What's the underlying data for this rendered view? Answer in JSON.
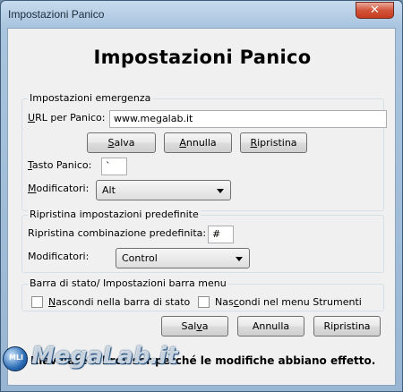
{
  "window": {
    "title": "Impostazioni Panico",
    "close_glyph": "✕"
  },
  "heading": "Impostazioni Panico",
  "emergency": {
    "legend": "Impostazioni emergenza",
    "url_label_u": "U",
    "url_label_rest": "RL per Panico:",
    "url_value": "www.megalab.it",
    "save_u": "S",
    "save_rest": "alva",
    "cancel_u": "A",
    "cancel_rest": "nnulla",
    "restore_u": "R",
    "restore_rest": "ipristina",
    "key_label_u": "T",
    "key_label_rest": "asto Panico:",
    "key_value": "`",
    "modifiers_label_u": "M",
    "modifiers_label_rest": "odificatori:",
    "modifiers_value": "Alt"
  },
  "defaults": {
    "legend": "Ripristina impostazioni predefinite",
    "combo_label": "Ripristina combinazione predefinita:",
    "combo_value": "#",
    "modifiers_label": "Modificatori:",
    "modifiers_value": "Control"
  },
  "statusbar": {
    "legend": "Barra di stato/ Impostazioni barra menu",
    "hide_status_u": "N",
    "hide_status_rest": "ascondi nella barra di stato",
    "hide_menu_pre": "Nas",
    "hide_menu_u": "c",
    "hide_menu_rest": "ondi nel menu Strumenti"
  },
  "bottom": {
    "save_pre": "Sal",
    "save_u": "v",
    "save_rest": "a",
    "cancel": "Annulla",
    "restore": "Ripristina"
  },
  "footer_note": "Riavviare il browser perché le modifiche abbiano effetto.",
  "watermark": {
    "brand": "MegaLab.it",
    "badge": "MLI"
  }
}
